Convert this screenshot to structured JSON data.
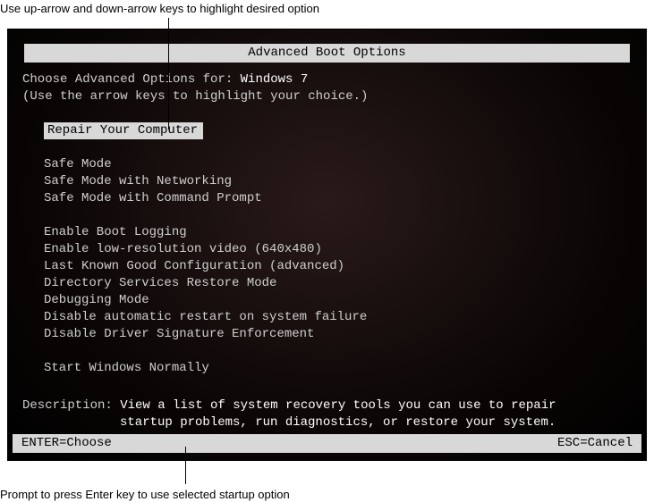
{
  "annotations": {
    "top": "Use up-arrow and down-arrow keys to highlight desired option",
    "bottom": "Prompt to press Enter key to use selected startup option"
  },
  "title": "Advanced Boot Options",
  "choose_prefix": "Choose Advanced Options for: ",
  "os_name": "Windows 7",
  "hint": "(Use the arrow keys to highlight your choice.)",
  "options": [
    {
      "label": "Repair Your Computer",
      "selected": true
    },
    {
      "label": "Safe Mode",
      "selected": false
    },
    {
      "label": "Safe Mode with Networking",
      "selected": false
    },
    {
      "label": "Safe Mode with Command Prompt",
      "selected": false
    },
    {
      "label": "Enable Boot Logging",
      "selected": false
    },
    {
      "label": "Enable low-resolution video (640x480)",
      "selected": false
    },
    {
      "label": "Last Known Good Configuration (advanced)",
      "selected": false
    },
    {
      "label": "Directory Services Restore Mode",
      "selected": false
    },
    {
      "label": "Debugging Mode",
      "selected": false
    },
    {
      "label": "Disable automatic restart on system failure",
      "selected": false
    },
    {
      "label": "Disable Driver Signature Enforcement",
      "selected": false
    },
    {
      "label": "Start Windows Normally",
      "selected": false
    }
  ],
  "description": {
    "label": "Description: ",
    "line1": "View a list of system recovery tools you can use to repair",
    "line2": "startup problems, run diagnostics, or restore your system."
  },
  "footer": {
    "enter": "ENTER=Choose",
    "esc": "ESC=Cancel"
  }
}
